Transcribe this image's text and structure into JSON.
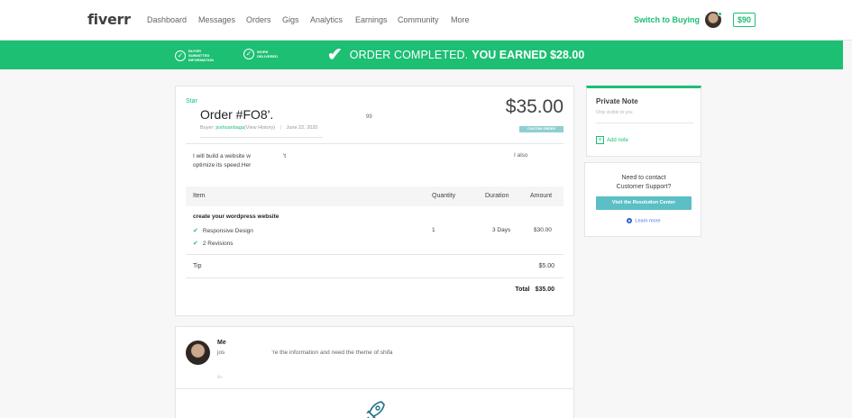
{
  "nav": {
    "logo": "fiverr",
    "links": [
      "Dashboard",
      "Messages",
      "Orders",
      "Gigs",
      "Analytics",
      "Earnings",
      "Community",
      "More"
    ],
    "switch_label": "Switch to Buying",
    "balance": "$90"
  },
  "banner": {
    "step1": "BUYER SUBMITTED INFORMATION",
    "step2": "WORK DELIVERED",
    "message_regular": "ORDER COMPLETED.",
    "message_bold": "YOU EARNED $28.00"
  },
  "order": {
    "status_tag": "Star",
    "title": "Order #FO8",
    "title_suffix": "'.",
    "gig_fragment": "99",
    "buyer_label": "Buyer:",
    "buyer_name": "joshuanbaga",
    "buyer_history": "(View History)",
    "date": "June 22, 2020",
    "price": "$35.00",
    "badge": "CUSTOM ORDER",
    "description_line1": "I will build a website w",
    "description_line1_end": "'t",
    "description_line2": "optimize its speed.Her",
    "description_fragment": "I also",
    "columns": [
      "Item",
      "Quantity",
      "Duration",
      "Amount"
    ],
    "item_title": "create your wordpress website",
    "features": [
      "Responsive Design",
      "2 Revisions"
    ],
    "quantity": "1",
    "duration": "3 Days",
    "amount": "$30.00",
    "tip_label": "Tip",
    "tip_amount": "$5.00",
    "total_label": "Total",
    "total_amount": "$35.00"
  },
  "private_note": {
    "title": "Private Note",
    "subtitle": "Only visible to you",
    "add_label": "Add note"
  },
  "support": {
    "line1": "Need to contact",
    "line2": "Customer Support?",
    "button": "Visit the Resolution Center",
    "learn_more": "Learn more"
  },
  "message": {
    "author": "Me",
    "text_start": "jos",
    "text_end": "'re the information and need the theme of shifa",
    "meta": "file"
  },
  "colors": {
    "brand_green": "#1dbf73",
    "badge_teal": "#8ecfd1",
    "button_teal": "#5bbfc5",
    "link_blue": "#4a73e8"
  }
}
